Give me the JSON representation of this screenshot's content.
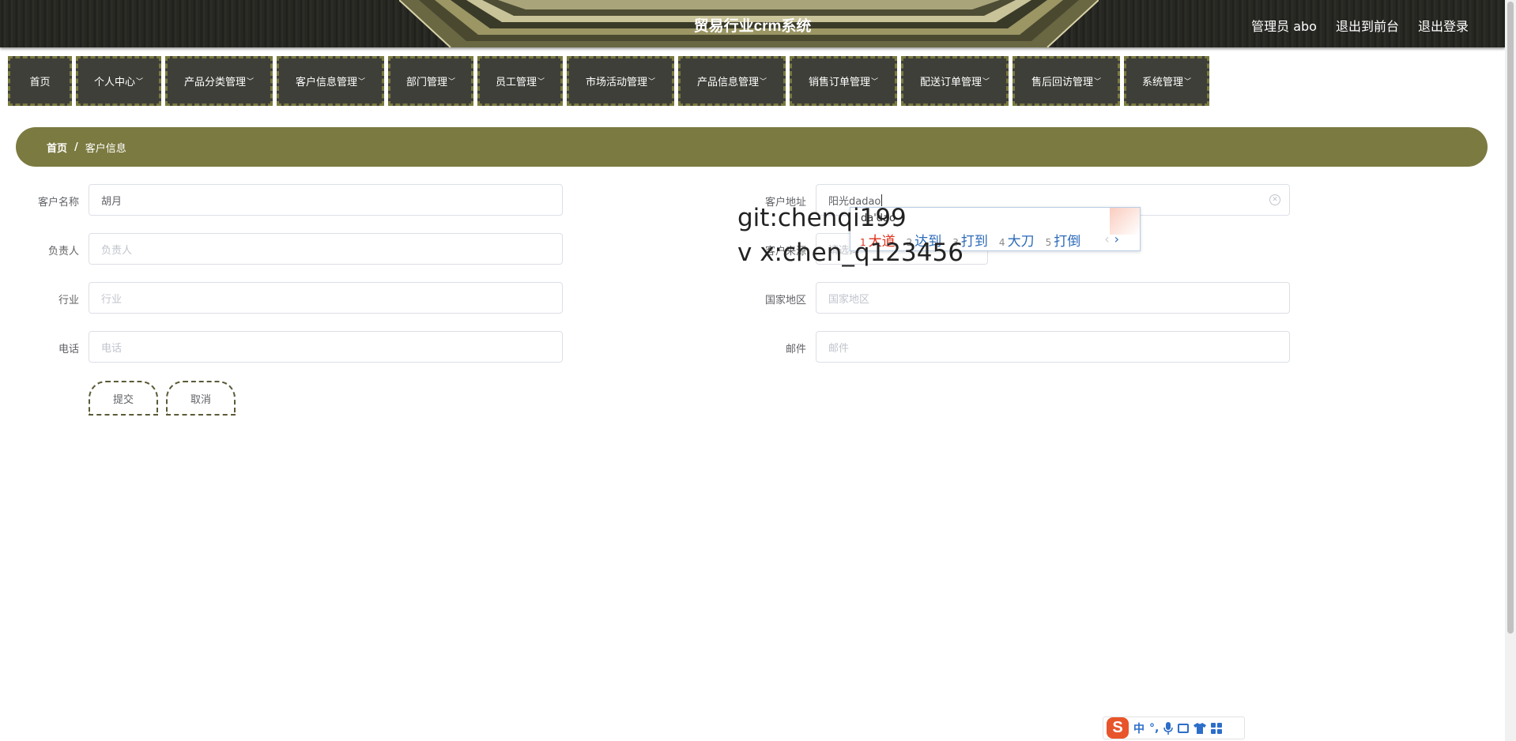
{
  "header": {
    "title": "贸易行业crm系统",
    "links": [
      "管理员 abo",
      "退出到前台",
      "退出登录"
    ]
  },
  "nav": {
    "items": [
      {
        "label": "首页",
        "dropdown": false
      },
      {
        "label": "个人中心",
        "dropdown": true
      },
      {
        "label": "产品分类管理",
        "dropdown": true
      },
      {
        "label": "客户信息管理",
        "dropdown": true
      },
      {
        "label": "部门管理",
        "dropdown": true
      },
      {
        "label": "员工管理",
        "dropdown": true
      },
      {
        "label": "市场活动管理",
        "dropdown": true
      },
      {
        "label": "产品信息管理",
        "dropdown": true
      },
      {
        "label": "销售订单管理",
        "dropdown": true
      },
      {
        "label": "配送订单管理",
        "dropdown": true
      },
      {
        "label": "售后回访管理",
        "dropdown": true
      },
      {
        "label": "系统管理",
        "dropdown": true
      }
    ]
  },
  "breadcrumb": {
    "home": "首页",
    "separator": "/",
    "current": "客户信息"
  },
  "form": {
    "customer_name": {
      "label": "客户名称",
      "value": "胡月",
      "placeholder": ""
    },
    "owner": {
      "label": "负责人",
      "value": "",
      "placeholder": "负责人"
    },
    "industry": {
      "label": "行业",
      "value": "",
      "placeholder": "行业"
    },
    "phone": {
      "label": "电话",
      "value": "",
      "placeholder": "电话"
    },
    "address": {
      "label": "客户地址",
      "value": "阳光dadao",
      "placeholder": ""
    },
    "source": {
      "label": "客户来源",
      "value": "",
      "placeholder": "请选择"
    },
    "country": {
      "label": "国家地区",
      "value": "",
      "placeholder": "国家地区"
    },
    "email": {
      "label": "邮件",
      "value": "",
      "placeholder": "邮件"
    },
    "submit_label": "提交",
    "cancel_label": "取消"
  },
  "ime": {
    "composition": "da'dao",
    "candidates": [
      {
        "index": "1",
        "text": "大道"
      },
      {
        "index": "2",
        "text": "达到"
      },
      {
        "index": "3",
        "text": "打到"
      },
      {
        "index": "4",
        "text": "大刀"
      },
      {
        "index": "5",
        "text": "打倒"
      }
    ],
    "prev_arrow": "‹",
    "next_arrow": "›"
  },
  "watermark": {
    "line1": "git:chenqi199",
    "line2": "v x:chen_q123456"
  },
  "ime_toolbar": {
    "logo": "S",
    "mode": "中",
    "punct": "°,"
  },
  "colors": {
    "accent": "#7b7a40",
    "nav_bg": "#3f3f3a",
    "nav_border": "#7a7a3e"
  }
}
